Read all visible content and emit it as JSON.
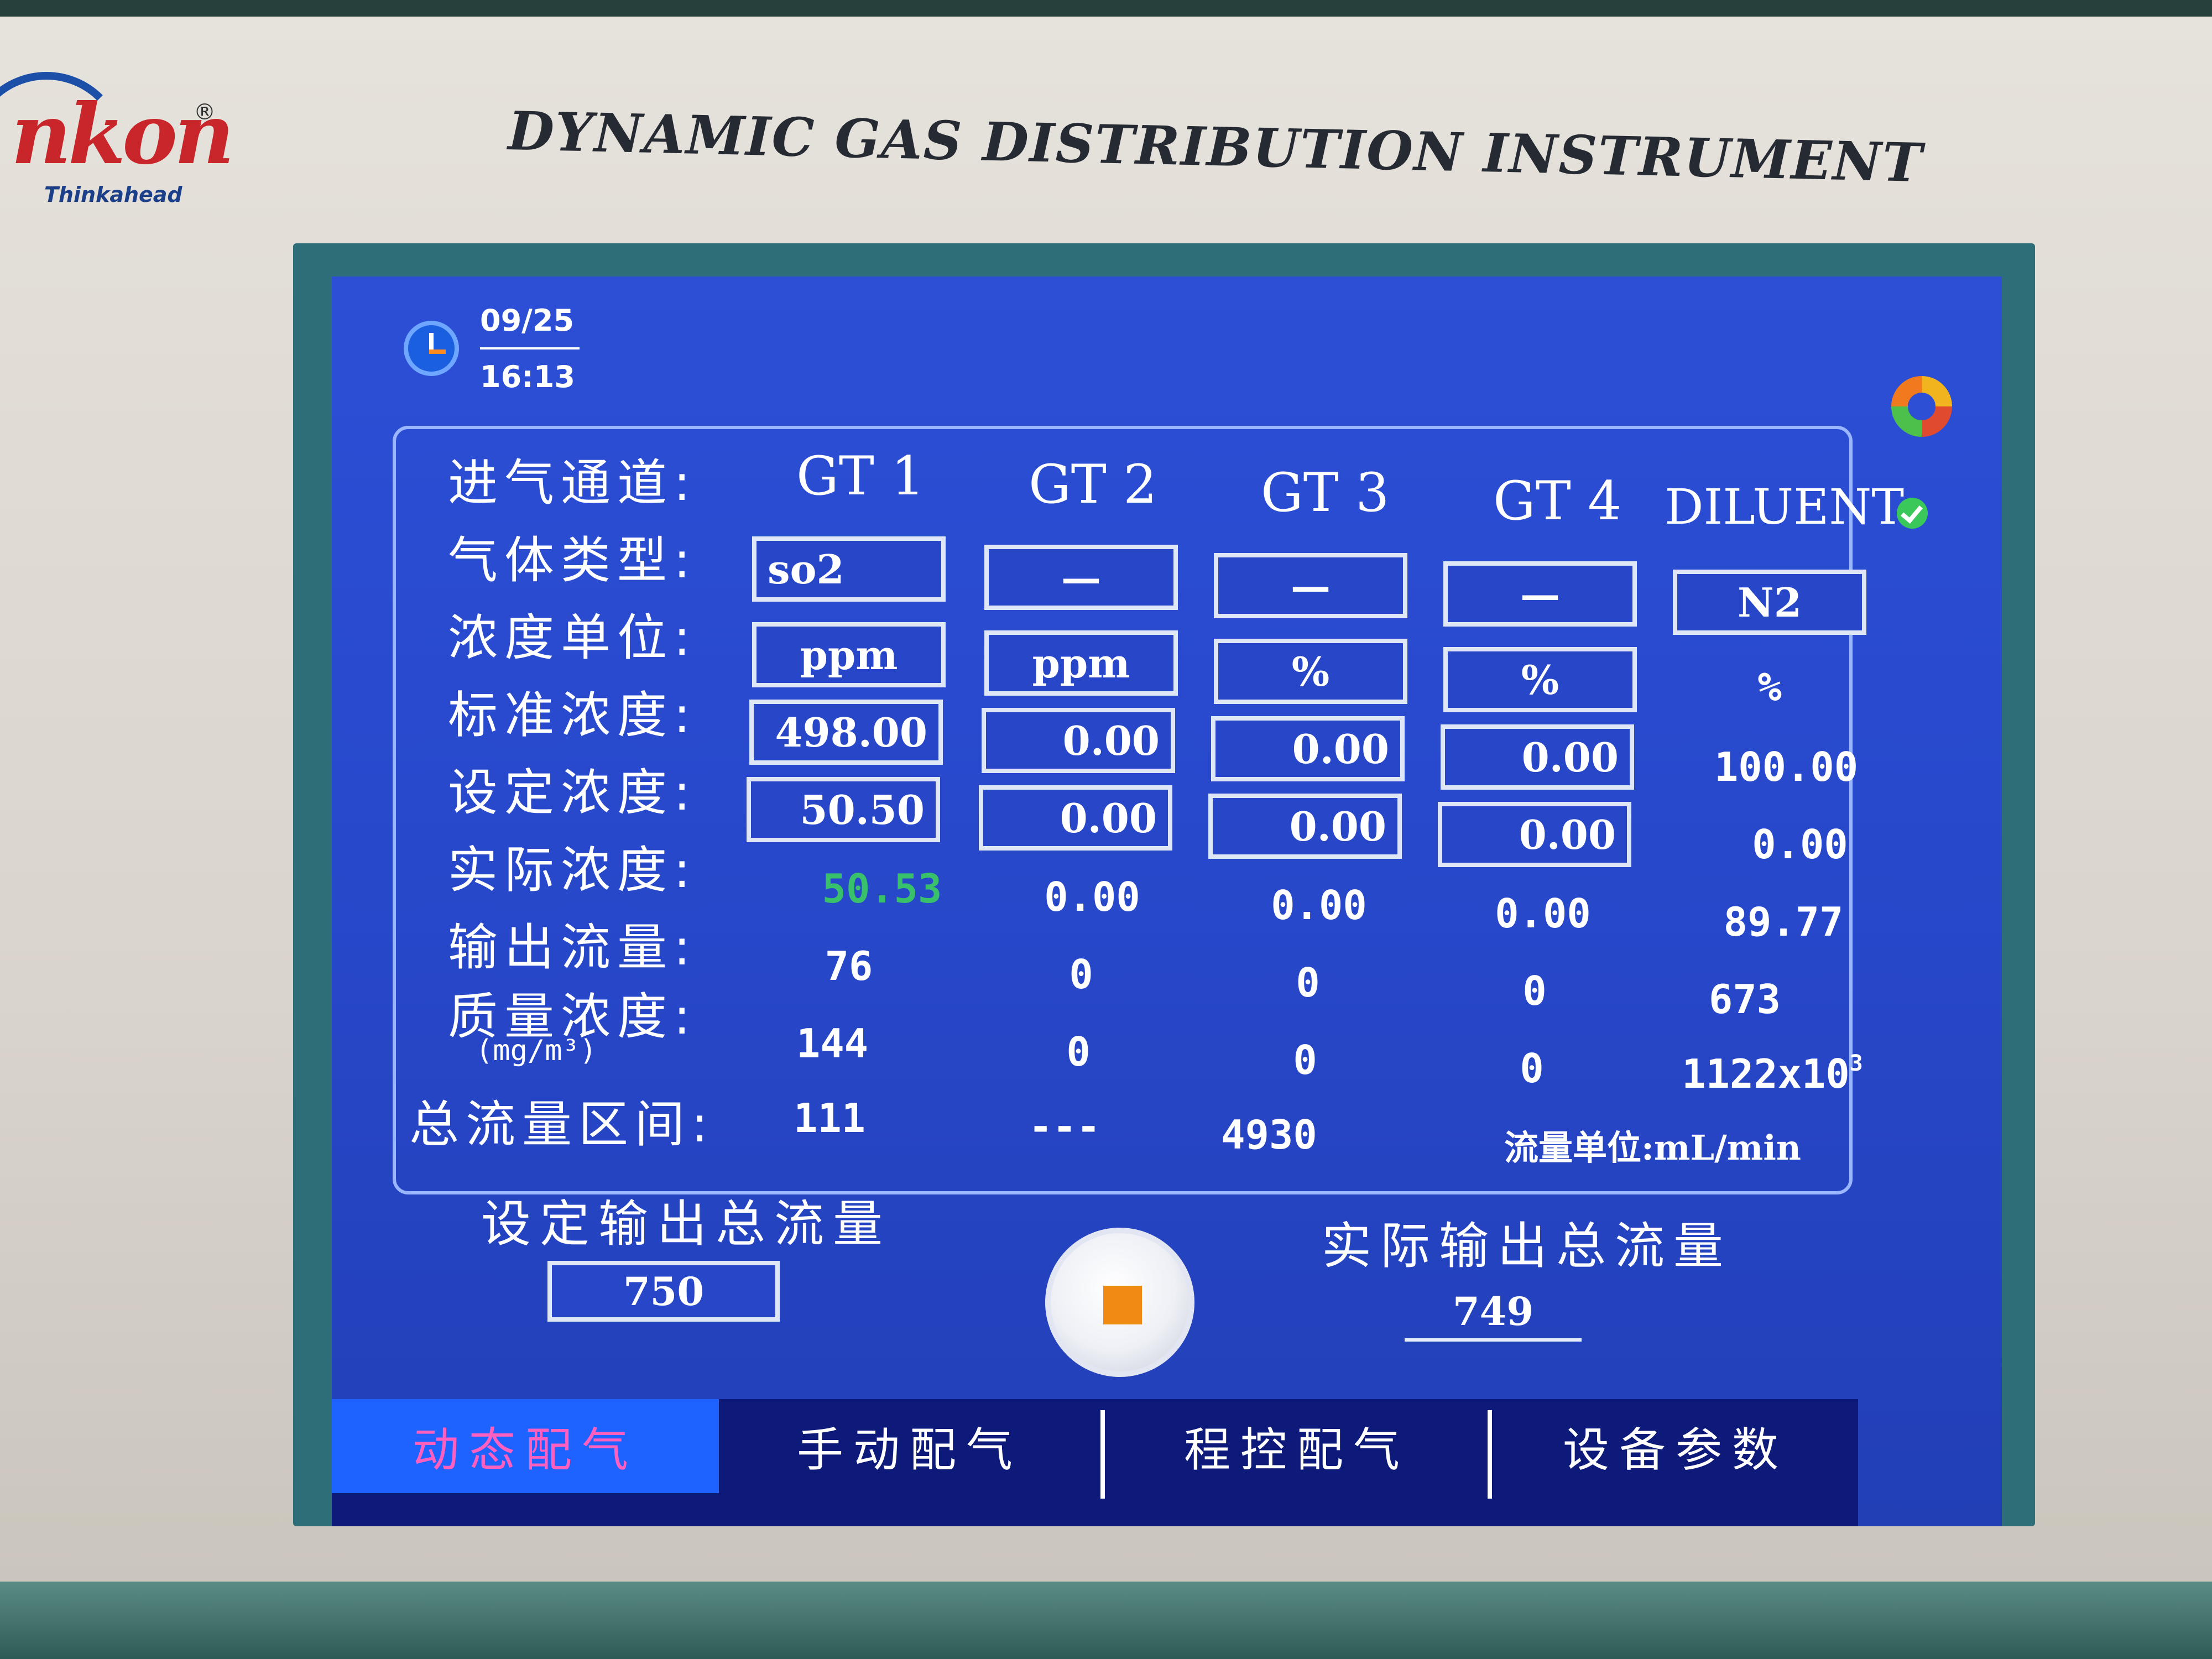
{
  "device": {
    "brand": "nkon",
    "tagline": "Thinkahead",
    "title": "DYNAMIC GAS DISTRIBUTION INSTRUMENT"
  },
  "status": {
    "date": "09/25",
    "time": "16:13"
  },
  "labels": {
    "channel": "进气通道:",
    "gas_type": "气体类型:",
    "unit": "浓度单位:",
    "std_conc": "标准浓度:",
    "set_conc": "设定浓度:",
    "actual_conc": "实际浓度:",
    "output_flow": "输出流量:",
    "mass_conc": "质量浓度:",
    "mass_conc_unit": "(mg/m³)",
    "flow_range": "总流量区间:"
  },
  "channels": [
    {
      "name": "GT 1",
      "gas_type": "so2",
      "unit": "ppm",
      "std_conc": "498.00",
      "set_conc": "50.50",
      "actual_conc": "50.53",
      "output_flow": "76",
      "mass_conc": "144",
      "flow_range": "111"
    },
    {
      "name": "GT 2",
      "gas_type": "—",
      "unit": "ppm",
      "std_conc": "0.00",
      "set_conc": "0.00",
      "actual_conc": "0.00",
      "output_flow": "0",
      "mass_conc": "0",
      "flow_range": "---"
    },
    {
      "name": "GT 3",
      "gas_type": "—",
      "unit": "%",
      "std_conc": "0.00",
      "set_conc": "0.00",
      "actual_conc": "0.00",
      "output_flow": "0",
      "mass_conc": "0",
      "flow_range": "4930"
    },
    {
      "name": "GT 4",
      "gas_type": "—",
      "unit": "%",
      "std_conc": "0.00",
      "set_conc": "0.00",
      "actual_conc": "0.00",
      "output_flow": "0",
      "mass_conc": "0"
    }
  ],
  "diluent": {
    "name": "DILUENT",
    "gas_type": "N2",
    "unit": "%",
    "std_conc": "100.00",
    "set_conc": "0.00",
    "actual_conc": "89.77",
    "output_flow": "673",
    "mass_conc": "1122x10",
    "mass_conc_exp": "3"
  },
  "flow_unit_note": "流量单位:mL/min",
  "set_total": {
    "label": "设定输出总流量",
    "value": "750"
  },
  "actual_total": {
    "label": "实际输出总流量",
    "value": "749"
  },
  "tabs": [
    {
      "label": "动态配气",
      "active": true
    },
    {
      "label": "手动配气",
      "active": false
    },
    {
      "label": "程控配气",
      "active": false
    },
    {
      "label": "设备参数",
      "active": false
    }
  ],
  "colors": {
    "screen_bg": "#2c4fd6",
    "actual_highlight": "#39c06a",
    "active_tab": "#1e63ff",
    "active_tab_text": "#ff5fbf",
    "stop_icon": "#f08a12"
  }
}
